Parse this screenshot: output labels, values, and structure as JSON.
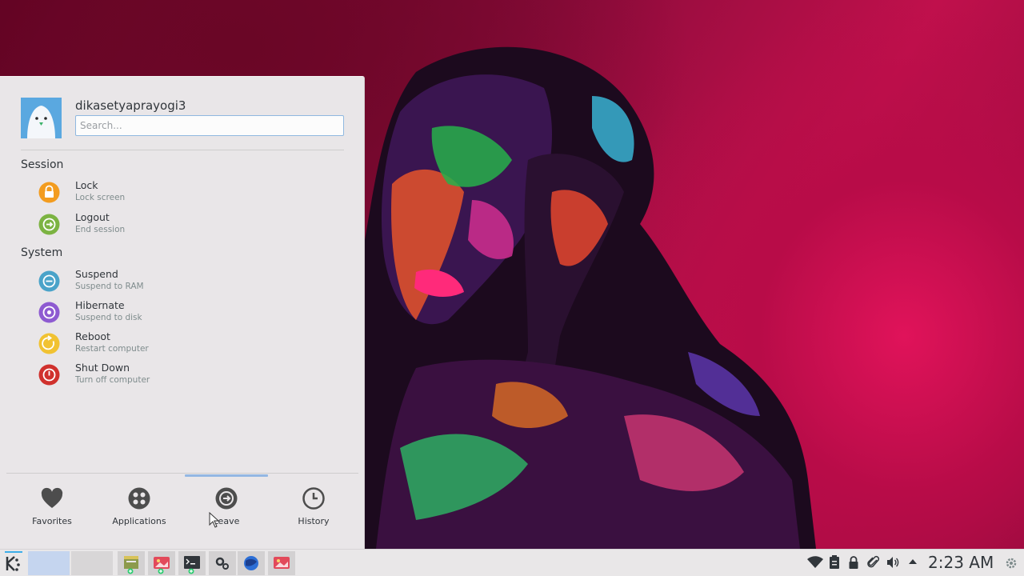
{
  "user": {
    "name": "dikasetyaprayogi3"
  },
  "search": {
    "placeholder": "Search..."
  },
  "sections": {
    "session": "Session",
    "system": "System"
  },
  "items": {
    "lock": {
      "title": "Lock",
      "subtitle": "Lock screen",
      "color": "#f39c1f"
    },
    "logout": {
      "title": "Logout",
      "subtitle": "End session",
      "color": "#7cb342"
    },
    "suspend": {
      "title": "Suspend",
      "subtitle": "Suspend to RAM",
      "color": "#4aa3c9"
    },
    "hibernate": {
      "title": "Hibernate",
      "subtitle": "Suspend to disk",
      "color": "#8e5bd1"
    },
    "reboot": {
      "title": "Reboot",
      "subtitle": "Restart computer",
      "color": "#f1c232"
    },
    "shutdown": {
      "title": "Shut Down",
      "subtitle": "Turn off computer",
      "color": "#d0312d"
    }
  },
  "tabs": {
    "favorites": "Favorites",
    "applications": "Applications",
    "leave": "Leave",
    "history": "History"
  },
  "taskbar": {
    "clock": "2:23 AM"
  }
}
